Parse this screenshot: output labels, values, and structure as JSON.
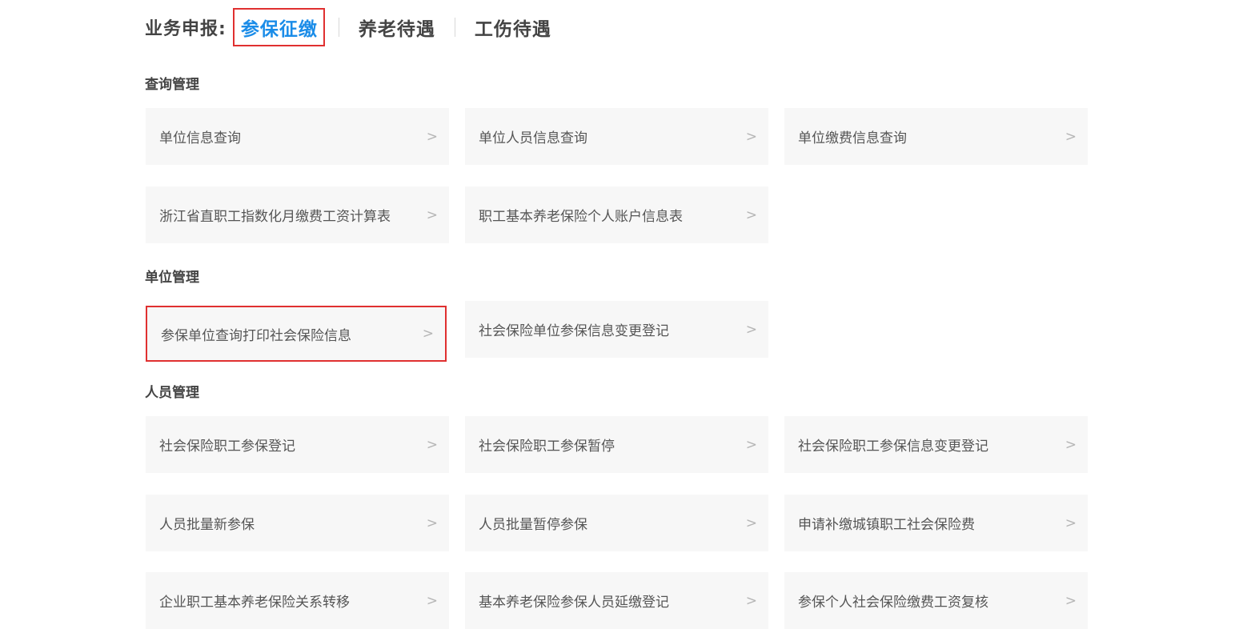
{
  "header": {
    "label": "业务申报:",
    "tabs": [
      {
        "label": "参保征缴",
        "active": true
      },
      {
        "label": "养老待遇",
        "active": false
      },
      {
        "label": "工伤待遇",
        "active": false
      }
    ]
  },
  "arrow": ">",
  "colors": {
    "accent": "#1a8ce8",
    "highlight_border": "#e03030",
    "card_bg": "#f7f7f7"
  },
  "sections": [
    {
      "title": "查询管理",
      "items": [
        "单位信息查询",
        "单位人员信息查询",
        "单位缴费信息查询",
        "浙江省直职工指数化月缴费工资计算表",
        "职工基本养老保险个人账户信息表"
      ]
    },
    {
      "title": "单位管理",
      "items": [
        "参保单位查询打印社会保险信息",
        "社会保险单位参保信息变更登记"
      ]
    },
    {
      "title": "人员管理",
      "items": [
        "社会保险职工参保登记",
        "社会保险职工参保暂停",
        "社会保险职工参保信息变更登记",
        "人员批量新参保",
        "人员批量暂停参保",
        "申请补缴城镇职工社会保险费",
        "企业职工基本养老保险关系转移",
        "基本养老保险参保人员延缴登记",
        "参保个人社会保险缴费工资复核"
      ]
    }
  ]
}
